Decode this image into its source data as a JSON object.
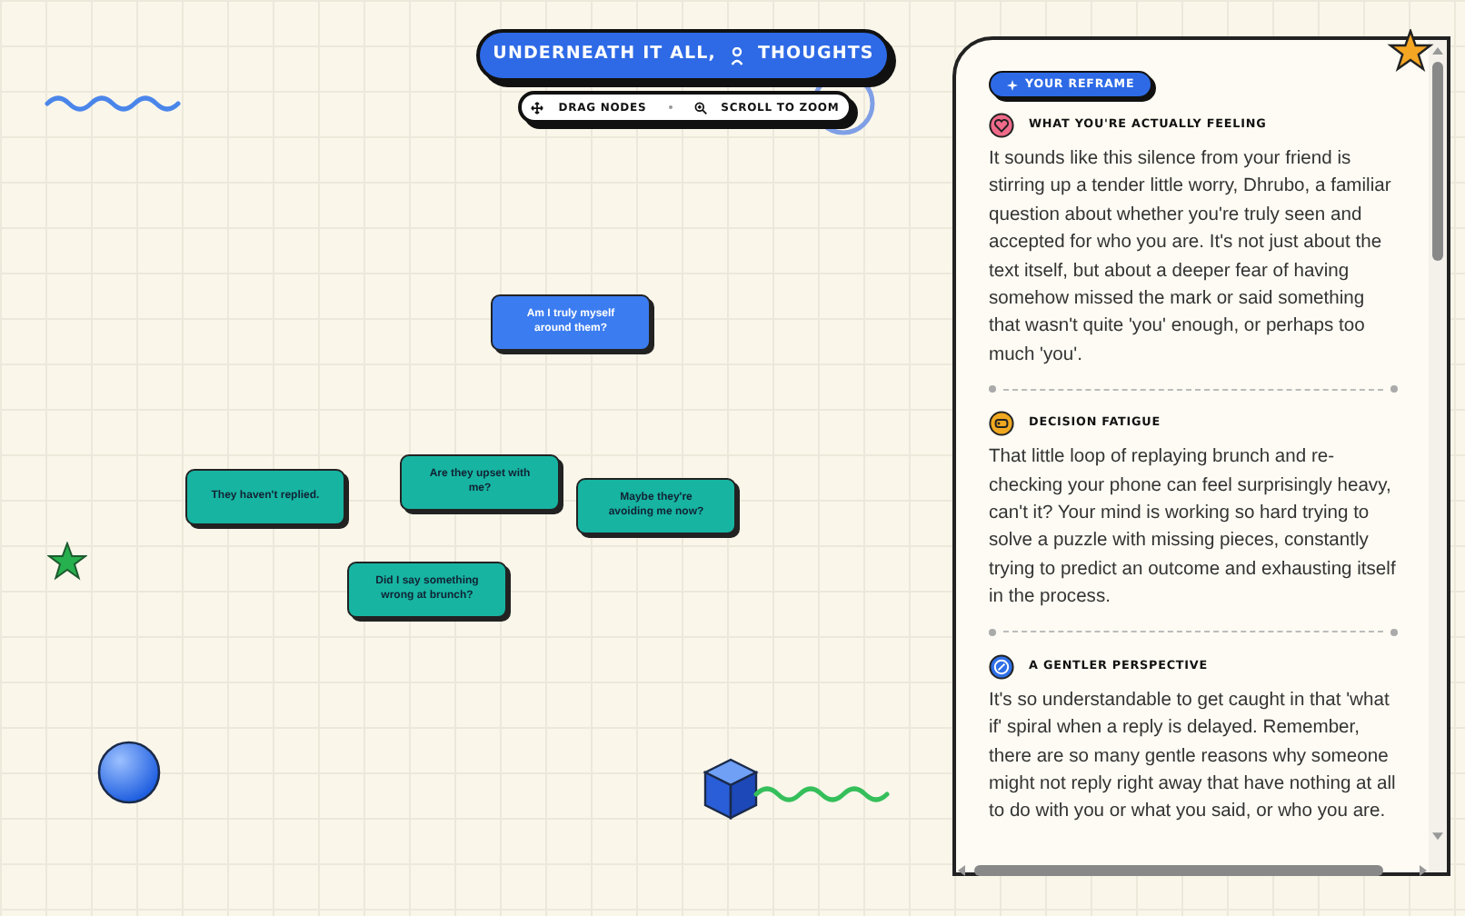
{
  "title": {
    "parts": [
      "UNDERNEATH IT ALL,",
      "THOUGHTS"
    ]
  },
  "hints": [
    {
      "kind": "drag",
      "label": "DRAG NODES"
    },
    {
      "kind": "zoom",
      "label": "SCROLL TO ZOOM"
    }
  ],
  "nodes": [
    {
      "text": "Am I truly myself around them?",
      "color": "#3b7cf0"
    },
    {
      "text": "They haven't replied.",
      "color": "#17b4a2"
    },
    {
      "text": "Are they upset with me?",
      "color": "#17b4a2"
    },
    {
      "text": "Maybe they're avoiding me now?",
      "color": "#17b4a2"
    },
    {
      "text": "Did I say something wrong at brunch?",
      "color": "#17b4a2"
    }
  ],
  "panel": {
    "badge": "YOUR REFRAME",
    "sections": [
      {
        "kind": "heart",
        "color": "#f06a8a",
        "heading": "WHAT YOU'RE ACTUALLY FEELING",
        "body": "It sounds like this silence from your friend is stirring up a tender little worry, Dhrubo, a familiar question about whether you're truly seen and accepted for who you are. It's not just about the text itself, but about a deeper fear of having somehow missed the mark or said something that wasn't quite 'you' enough, or perhaps too much 'you'."
      },
      {
        "kind": "tag",
        "color": "#f0a820",
        "heading": "DECISION FATIGUE",
        "body": "That little loop of replaying brunch and re-checking your phone can feel surprisingly heavy, can't it? Your mind is working so hard trying to solve a puzzle with missing pieces, constantly trying to predict an outcome and exhausting itself in the process."
      },
      {
        "kind": "compass",
        "color": "#2f6fe6",
        "heading": "A GENTLER PERSPECTIVE",
        "body": "It's so understandable to get caught in that 'what if' spiral when a reply is delayed. Remember, there are so many gentle reasons why someone might not reply right away that have nothing at all to do with you or what you said, or who you are."
      }
    ]
  }
}
